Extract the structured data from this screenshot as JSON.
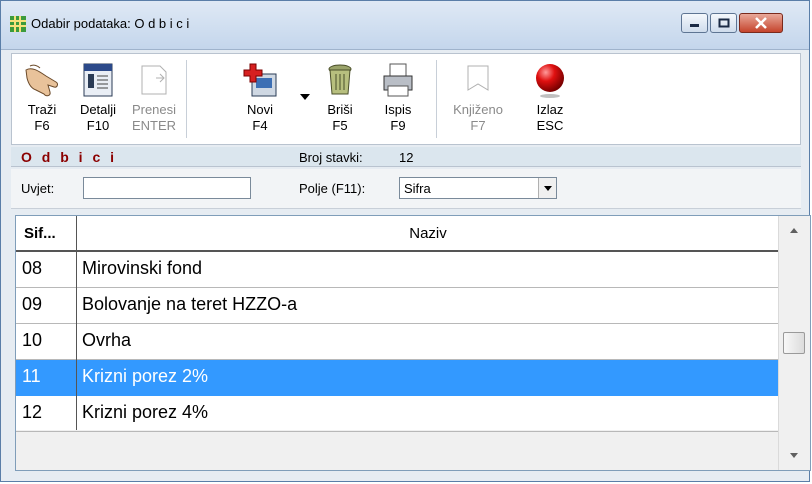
{
  "window": {
    "title": "Odabir podataka: O d b i c i",
    "icon": "grid-app-icon"
  },
  "toolbar": {
    "buttons": [
      {
        "label": "Traži",
        "key": "F6",
        "icon": "hand-pointer-icon",
        "enabled": true
      },
      {
        "label": "Detalji",
        "key": "F10",
        "icon": "details-window-icon",
        "enabled": true
      },
      {
        "label": "Prenesi",
        "key": "ENTER",
        "icon": "transfer-icon",
        "enabled": false
      },
      {
        "label": "Novi",
        "key": "F4",
        "icon": "new-record-icon",
        "enabled": true
      },
      {
        "label": "Briši",
        "key": "F5",
        "icon": "trash-can-icon",
        "enabled": true
      },
      {
        "label": "Ispis",
        "key": "F9",
        "icon": "printer-icon",
        "enabled": true
      },
      {
        "label": "Knjiženo",
        "key": "F7",
        "icon": "posted-icon",
        "enabled": false
      },
      {
        "label": "Izlaz",
        "key": "ESC",
        "icon": "exit-red-ball-icon",
        "enabled": true
      }
    ]
  },
  "strip": {
    "title": "O d b i c i",
    "count_label": "Broj stavki:",
    "count_value": "12"
  },
  "filter": {
    "condition_label": "Uvjet:",
    "condition_value": "",
    "field_label": "Polje (F11):",
    "field_value": "Sifra"
  },
  "grid": {
    "columns": [
      "Sif...",
      "Naziv"
    ],
    "rows": [
      {
        "code": "08",
        "name": "Mirovinski fond",
        "selected": false
      },
      {
        "code": "09",
        "name": "Bolovanje na teret HZZO-a",
        "selected": false
      },
      {
        "code": "10",
        "name": "Ovrha",
        "selected": false
      },
      {
        "code": "11",
        "name": "Krizni porez 2%",
        "selected": true
      },
      {
        "code": "12",
        "name": "Krizni porez 4%",
        "selected": false
      }
    ]
  },
  "colors": {
    "selection": "#3399ff",
    "strip_title": "#8b0000",
    "header_bg": "#dbe6ee"
  }
}
